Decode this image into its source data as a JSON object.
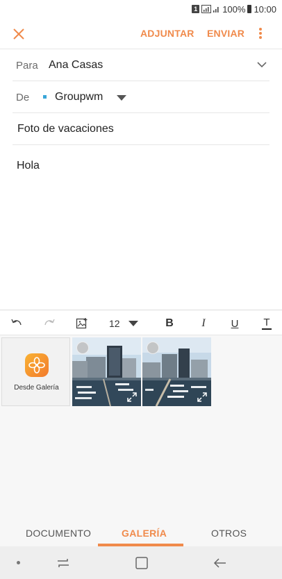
{
  "status_bar": {
    "sim": "1",
    "battery_percent": "100%",
    "time": "10:00"
  },
  "app_bar": {
    "attach_label": "ADJUNTAR",
    "send_label": "ENVIAR"
  },
  "fields": {
    "to_label": "Para",
    "to_value": "Ana Casas",
    "from_label": "De",
    "from_value": "Groupwm",
    "subject": "Foto de vacaciones"
  },
  "body": {
    "text": "Hola"
  },
  "toolbar": {
    "font_size": "12"
  },
  "attachments": {
    "gallery_tile_label": "Desde Galería"
  },
  "tabs": [
    {
      "label": "DOCUMENTO",
      "active": false
    },
    {
      "label": "GALERÍA",
      "active": true
    },
    {
      "label": "OTROS",
      "active": false
    }
  ],
  "colors": {
    "accent": "#f08a4b",
    "account_dot": "#3aa6d8"
  }
}
